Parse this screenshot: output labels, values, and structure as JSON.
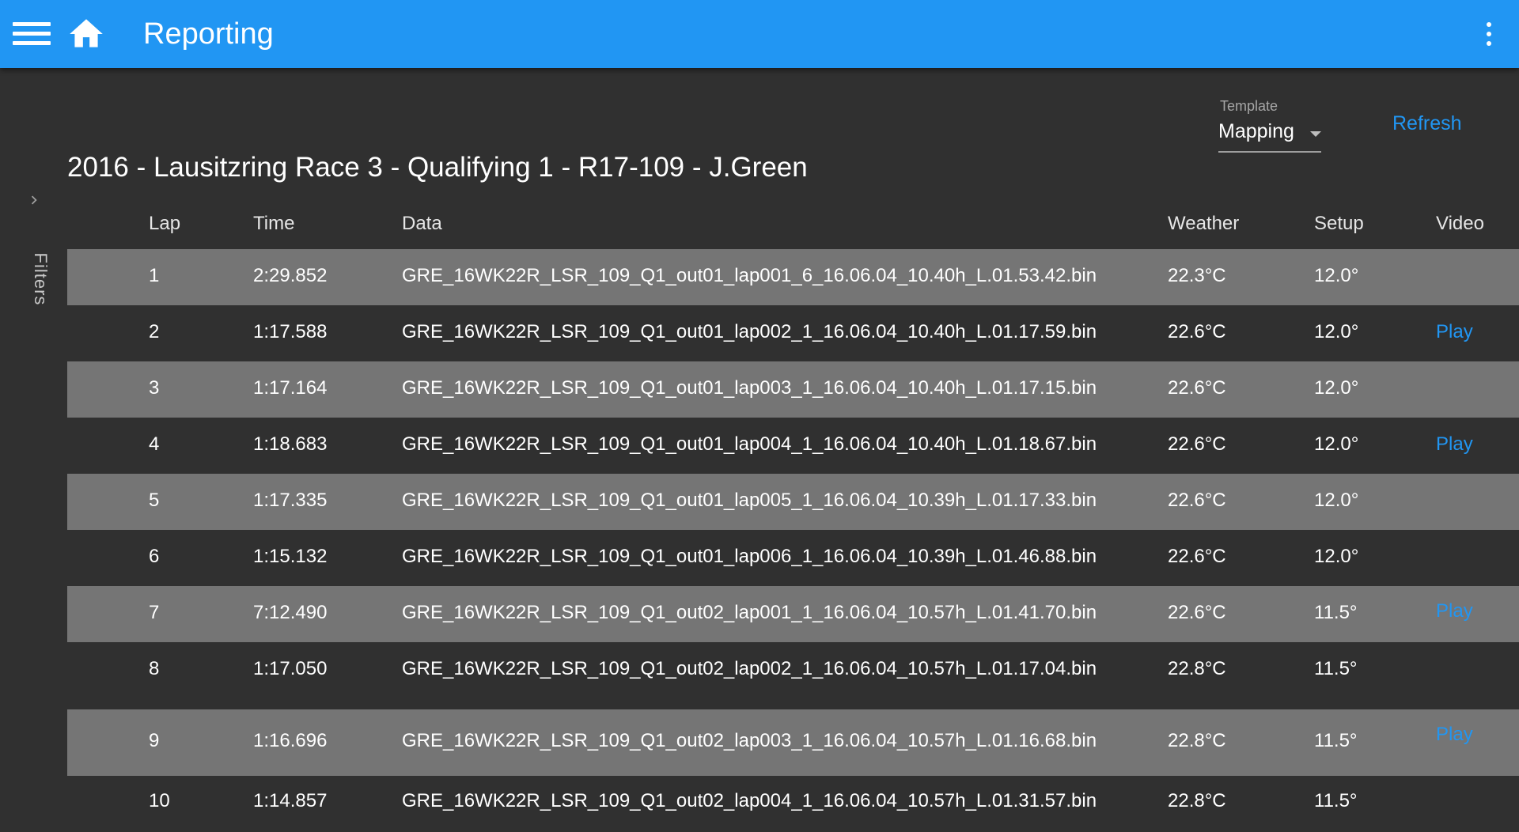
{
  "header": {
    "title": "Reporting",
    "menu_icon": "hamburger-menu-icon",
    "home_icon": "home-icon",
    "more_icon": "more-vert-icon",
    "color": "#2196f3"
  },
  "filters": {
    "label": "Filters",
    "icon": "chevron-right-icon"
  },
  "template": {
    "label": "Template",
    "value": "Mapping"
  },
  "refresh_label": "Refresh",
  "session_title": "2016 - Lausitzring Race 3 - Qualifying 1 - R17-109 - J.Green",
  "table": {
    "headers": {
      "lap": "Lap",
      "time": "Time",
      "data": "Data",
      "weather": "Weather",
      "setup": "Setup",
      "video": "Video"
    },
    "rows": [
      {
        "lap": "1",
        "time": "2:29.852",
        "data": "GRE_16WK22R_LSR_109_Q1_out01_lap001_6_16.06.04_10.40h_L.01.53.42.bin",
        "weather": "22.3°C",
        "setup": "12.0°",
        "video": ""
      },
      {
        "lap": "2",
        "time": "1:17.588",
        "data": "GRE_16WK22R_LSR_109_Q1_out01_lap002_1_16.06.04_10.40h_L.01.17.59.bin",
        "weather": "22.6°C",
        "setup": "12.0°",
        "video": "Play"
      },
      {
        "lap": "3",
        "time": "1:17.164",
        "data": "GRE_16WK22R_LSR_109_Q1_out01_lap003_1_16.06.04_10.40h_L.01.17.15.bin",
        "weather": "22.6°C",
        "setup": "12.0°",
        "video": ""
      },
      {
        "lap": "4",
        "time": "1:18.683",
        "data": "GRE_16WK22R_LSR_109_Q1_out01_lap004_1_16.06.04_10.40h_L.01.18.67.bin",
        "weather": "22.6°C",
        "setup": "12.0°",
        "video": "Play"
      },
      {
        "lap": "5",
        "time": "1:17.335",
        "data": "GRE_16WK22R_LSR_109_Q1_out01_lap005_1_16.06.04_10.39h_L.01.17.33.bin",
        "weather": "22.6°C",
        "setup": "12.0°",
        "video": ""
      },
      {
        "lap": "6",
        "time": "1:15.132",
        "data": "GRE_16WK22R_LSR_109_Q1_out01_lap006_1_16.06.04_10.39h_L.01.46.88.bin",
        "weather": "22.6°C",
        "setup": "12.0°",
        "video": ""
      },
      {
        "lap": "7",
        "time": "7:12.490",
        "data": "GRE_16WK22R_LSR_109_Q1_out02_lap001_1_16.06.04_10.57h_L.01.41.70.bin",
        "weather": "22.6°C",
        "setup": "11.5°",
        "video": "Play"
      },
      {
        "lap": "8",
        "time": "1:17.050",
        "data": "GRE_16WK22R_LSR_109_Q1_out02_lap002_1_16.06.04_10.57h_L.01.17.04.bin",
        "weather": "22.8°C",
        "setup": "11.5°",
        "video": ""
      },
      {
        "lap": "9",
        "time": "1:16.696",
        "data": "GRE_16WK22R_LSR_109_Q1_out02_lap003_1_16.06.04_10.57h_L.01.16.68.bin",
        "weather": "22.8°C",
        "setup": "11.5°",
        "video": "Play"
      },
      {
        "lap": "10",
        "time": "1:14.857",
        "data": "GRE_16WK22R_LSR_109_Q1_out02_lap004_1_16.06.04_10.57h_L.01.31.57.bin",
        "weather": "22.8°C",
        "setup": "11.5°",
        "video": ""
      }
    ]
  }
}
